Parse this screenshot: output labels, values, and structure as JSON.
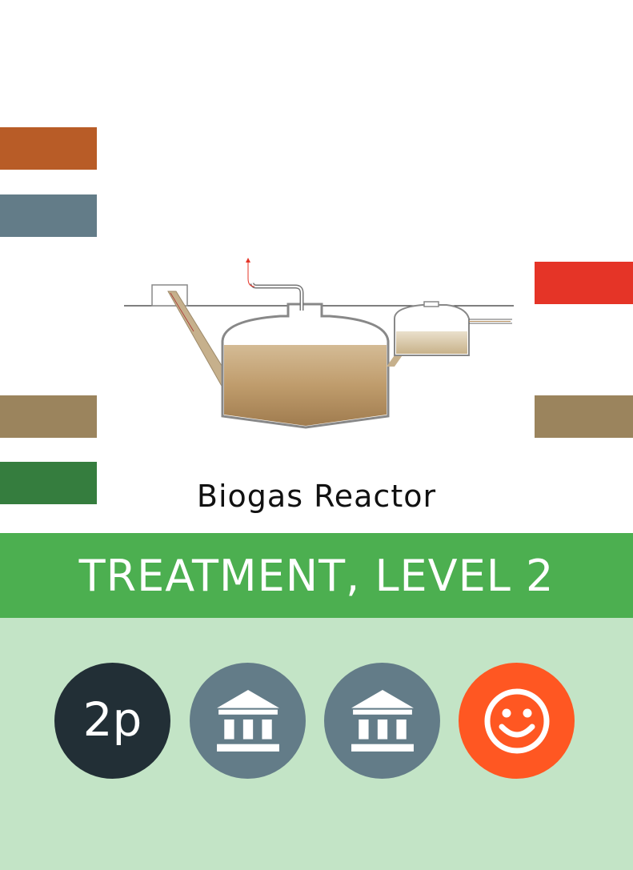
{
  "title": "Biogas Reactor",
  "banner": "TREATMENT, LEVEL 2",
  "colors": {
    "tab_left_1": "#b85c27",
    "tab_left_2": "#637c88",
    "tab_left_3": "#9b845d",
    "tab_left_4": "#357d3e",
    "tab_right_1": "#e53427",
    "tab_right_2": "#9b845d",
    "banner": "#4caf50",
    "bottom_panel": "#c3e4c6",
    "badge_persons": "#222f36",
    "badge_institution": "#637c88",
    "badge_acceptance": "#ff5722"
  },
  "badges": [
    {
      "label": "2p",
      "icon": "persons-text"
    },
    {
      "label": "",
      "icon": "institution-icon"
    },
    {
      "label": "",
      "icon": "institution-icon"
    },
    {
      "label": "",
      "icon": "smiley-icon"
    }
  ]
}
